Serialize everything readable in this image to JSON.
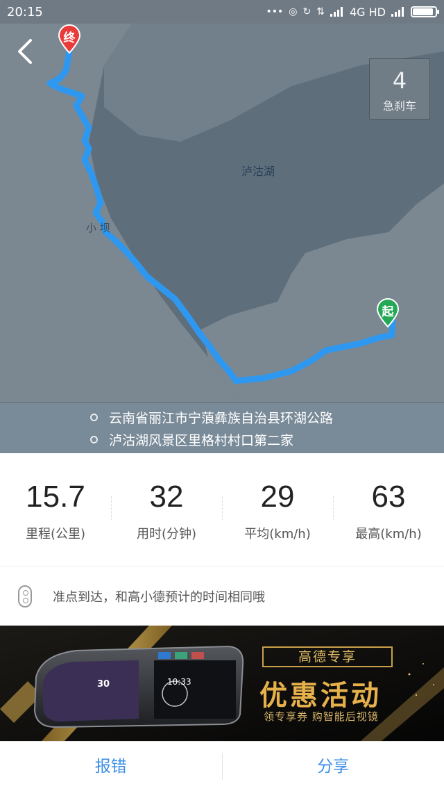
{
  "status_bar": {
    "time": "20:15",
    "network": "4G HD",
    "battery_level": 0.85,
    "icons": [
      "more-dots-icon",
      "wifi-hotspot-icon",
      "sync-icon",
      "data-arrows-icon",
      "signal-icon",
      "signal-icon",
      "battery-icon"
    ]
  },
  "map": {
    "back_icon": "chevron-left-icon",
    "hard_brake": {
      "count": "4",
      "label": "急刹车"
    },
    "lake_label": "泸沽湖",
    "town_label": "小 坝",
    "end_marker": "终",
    "start_marker": "起",
    "route_color": "#2e98f0",
    "water_color": "#5f6e7b",
    "land_color": "#7b8892"
  },
  "addresses": {
    "start": "云南省丽江市宁蒗彝族自治县环湖公路",
    "end": "泸沽湖风景区里格村村口第二家"
  },
  "stats": [
    {
      "value": "15.7",
      "label": "里程(公里)"
    },
    {
      "value": "32",
      "label": "用时(分钟)"
    },
    {
      "value": "29",
      "label": "平均(km/h)"
    },
    {
      "value": "63",
      "label": "最高(km/h)"
    }
  ],
  "tip": {
    "icon": "traffic-light-icon",
    "text": "准点到达，和高小德预计的时间相同哦"
  },
  "banner": {
    "tag": "高德专享",
    "title": "优惠活动",
    "subtitle": "领专享券 购智能后视镜",
    "mirror_speed": "30",
    "mirror_time": "10:33",
    "accent_color": "#e6b14a"
  },
  "bottom_bar": {
    "report": "报错",
    "share": "分享"
  }
}
